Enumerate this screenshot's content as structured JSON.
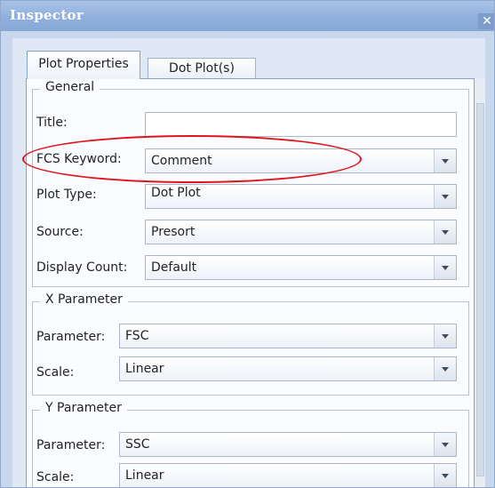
{
  "window": {
    "title": "Inspector",
    "close_glyph": "✕"
  },
  "tabs": [
    {
      "label": "Plot Properties",
      "active": true
    },
    {
      "label": "Dot Plot(s)",
      "active": false
    }
  ],
  "general": {
    "group_title": "General",
    "title_label": "Title:",
    "title_value": "",
    "fcs_keyword_label": "FCS Keyword:",
    "fcs_keyword_value": "Comment",
    "plot_type_label": "Plot Type:",
    "plot_type_value": "Dot Plot",
    "source_label": "Source:",
    "source_value": "Presort",
    "display_count_label": "Display Count:",
    "display_count_value": "Default"
  },
  "x_parameter": {
    "group_title": "X Parameter",
    "parameter_label": "Parameter:",
    "parameter_value": "FSC",
    "scale_label": "Scale:",
    "scale_value": "Linear"
  },
  "y_parameter": {
    "group_title": "Y Parameter",
    "parameter_label": "Parameter:",
    "parameter_value": "SSC",
    "scale_label": "Scale:",
    "scale_value": "Linear"
  },
  "annotation": {
    "color": "#e0141d",
    "target": "FCS Keyword"
  }
}
